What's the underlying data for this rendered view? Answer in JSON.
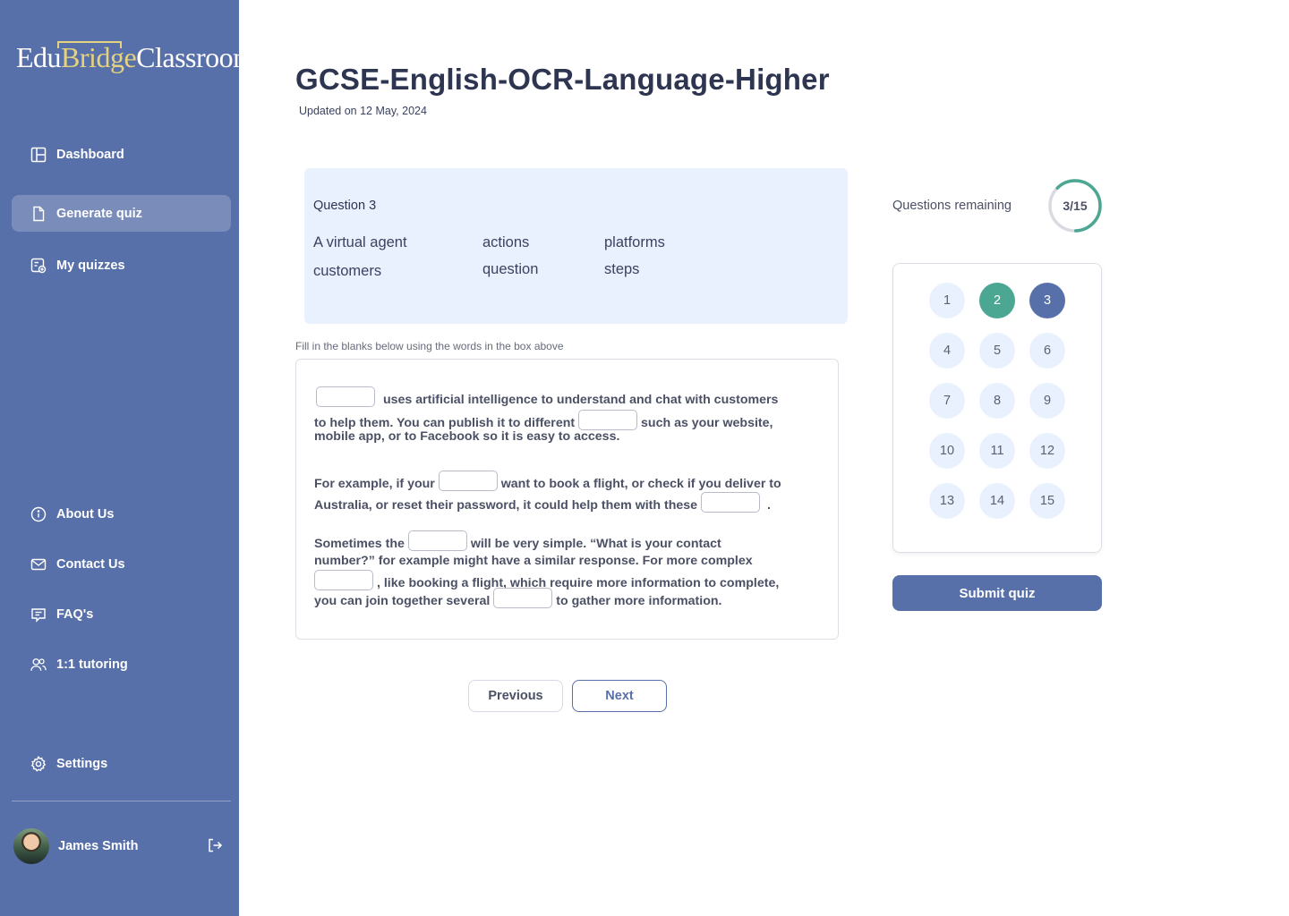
{
  "brand": {
    "part1": "Edu",
    "part2": "Bridge",
    "part3": "Classroom"
  },
  "sidebar": {
    "nav": [
      {
        "label": "Dashboard",
        "icon": "layout-icon"
      },
      {
        "label": "Generate quiz",
        "icon": "document-icon",
        "active": true
      },
      {
        "label": "My quizzes",
        "icon": "quiz-icon"
      }
    ],
    "secondary": [
      {
        "label": "About Us",
        "icon": "info-icon"
      },
      {
        "label": "Contact Us",
        "icon": "mail-icon"
      },
      {
        "label": "FAQ's",
        "icon": "chat-icon"
      },
      {
        "label": "1:1 tutoring",
        "icon": "users-icon"
      }
    ],
    "settings": {
      "label": "Settings",
      "icon": "gear-icon"
    },
    "user": {
      "name": "James Smith"
    }
  },
  "page": {
    "title": "GCSE-English-OCR-Language-Higher",
    "updated": "Updated on 12 May, 2024"
  },
  "question": {
    "label": "Question 3",
    "words": [
      "A virtual agent",
      "actions",
      "platforms",
      "customers",
      "question",
      "steps"
    ]
  },
  "passage": {
    "instruction": "Fill in the blanks below using the words in the box above",
    "p1": {
      "l1": "uses artificial intelligence to understand and chat with customers",
      "l2a": "to help them. You can publish it to different",
      "l2b": "such as your website,",
      "l3": "mobile app, or to Facebook so it is easy to access."
    },
    "p2": {
      "l1a": "For example, if your",
      "l1b": "want to book a flight, or check if you deliver to",
      "l2a": "Australia, or reset their password, it could help them with these",
      "l2b": "."
    },
    "p3": {
      "l1a": "Sometimes the",
      "l1b": "will be very simple. “What is your contact",
      "l2": "number?” for example might have a similar response. For more complex",
      "l3": ", like booking a flight, which require more information to complete,",
      "l4a": "you can join together several",
      "l4b": "to gather more information."
    }
  },
  "navigation": {
    "previous": "Previous",
    "next": "Next"
  },
  "progress": {
    "label": "Questions remaining",
    "text": "3/15",
    "current": 3,
    "total": 15,
    "color": "#4ba792"
  },
  "question_grid": {
    "numbers": [
      "1",
      "2",
      "3",
      "4",
      "5",
      "6",
      "7",
      "8",
      "9",
      "10",
      "11",
      "12",
      "13",
      "14",
      "15"
    ],
    "answered": [
      2
    ],
    "current": 3
  },
  "submit": "Submit quiz",
  "colors": {
    "primary": "#5870a9",
    "accent": "#4ba792",
    "light": "#e9f1ff"
  }
}
